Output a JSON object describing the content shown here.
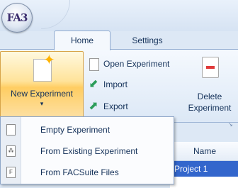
{
  "app": {
    "logo_text": "FA3"
  },
  "tabs": [
    {
      "label": "Home"
    },
    {
      "label": "Settings"
    }
  ],
  "ribbon": {
    "new_experiment": {
      "label": "New Experiment",
      "caret": "▾"
    },
    "open_experiment": "Open Experiment",
    "import": "Import",
    "export": "Export",
    "delete_experiment_line1": "Delete",
    "delete_experiment_line2": "Experiment",
    "group_launcher": "↘"
  },
  "dropdown": {
    "items": [
      {
        "label": "Empty Experiment",
        "icon": "blank-document-icon",
        "glyph": ""
      },
      {
        "label": "From Existing Experiment",
        "icon": "copy-document-icon",
        "glyph": "⁂"
      },
      {
        "label": "From FACSuite Files",
        "icon": "f-document-icon",
        "glyph": "F"
      }
    ]
  },
  "list": {
    "column_header": "Name",
    "rows": [
      "Project 1"
    ]
  },
  "colors": {
    "selection": "#3366cc",
    "hover_gold": "#ffcd62"
  }
}
